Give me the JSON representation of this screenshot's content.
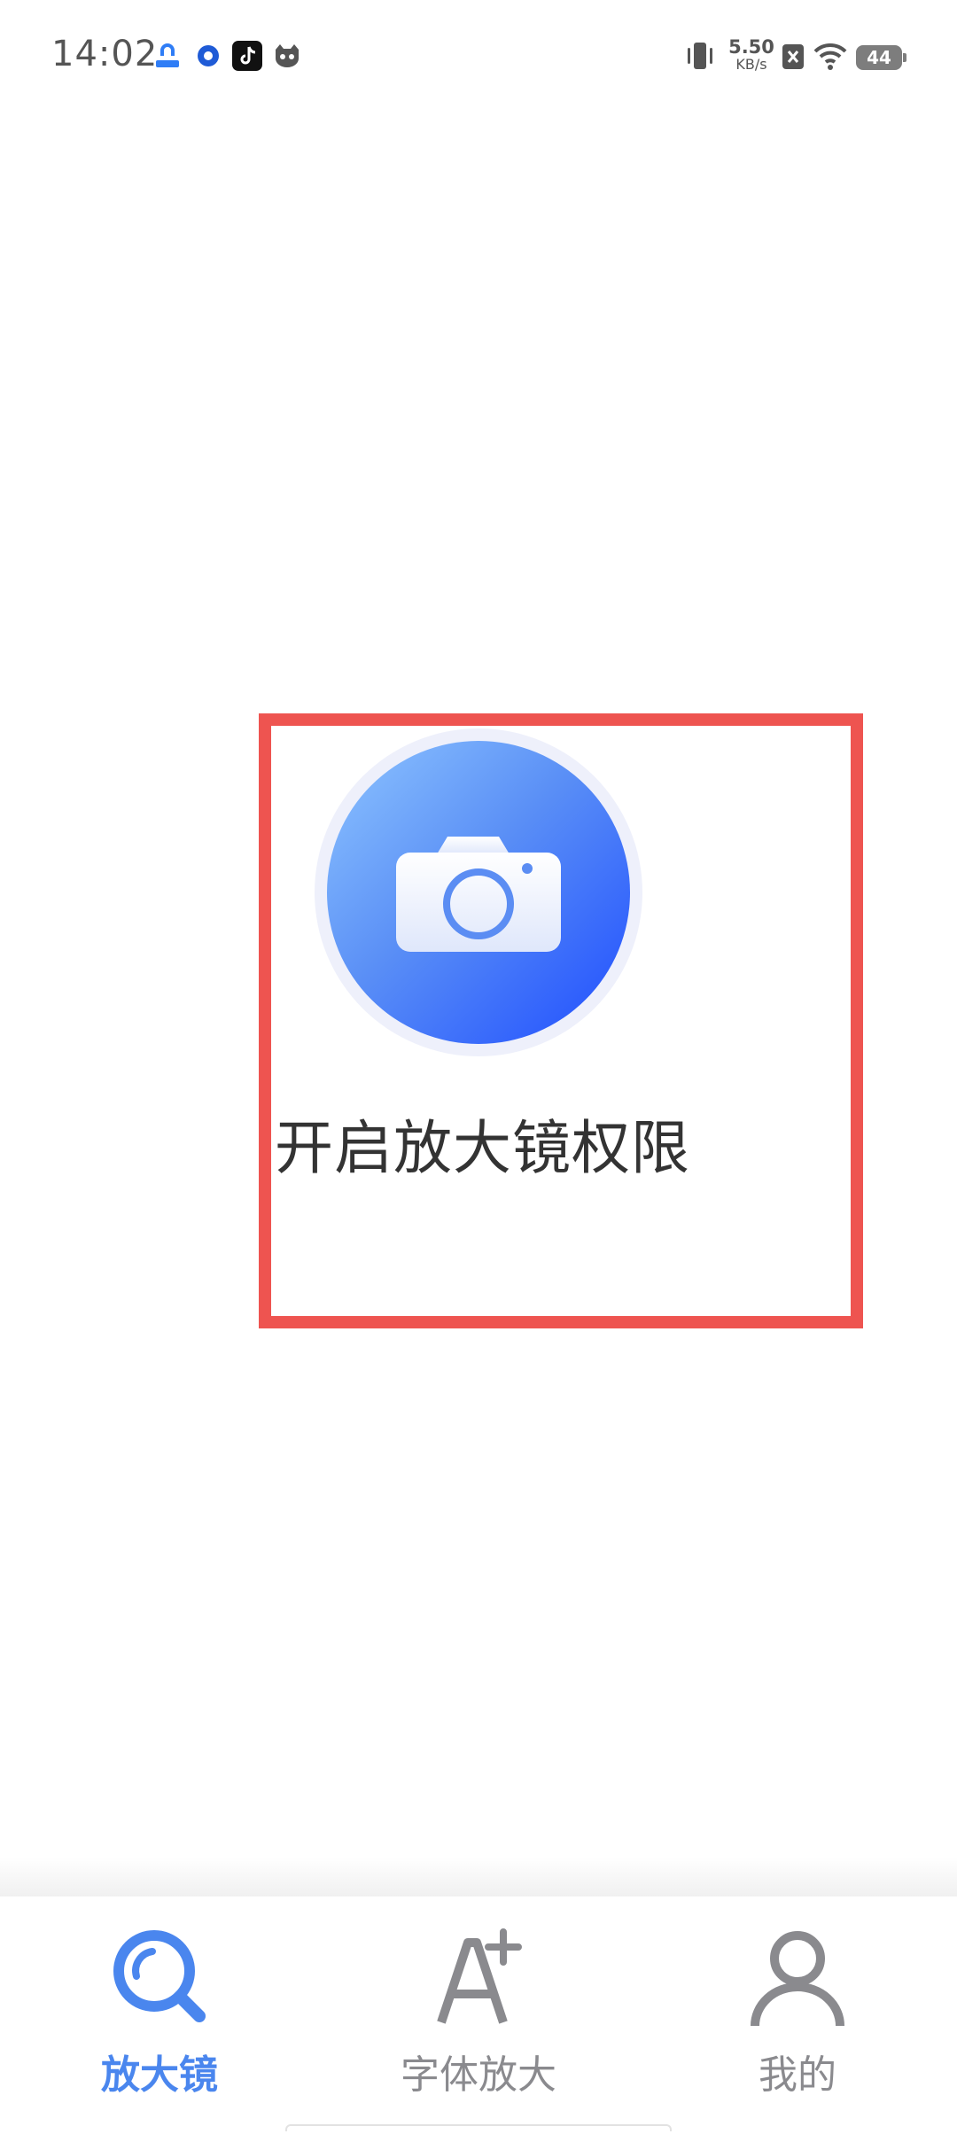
{
  "status_bar": {
    "time": "14:02",
    "net_speed_value": "5.50",
    "net_speed_unit": "KB/s",
    "battery_level": "44",
    "notification_icons": [
      "cloud-drive-icon",
      "browser-icon",
      "tiktok-icon",
      "cat-app-icon"
    ],
    "status_icons": [
      "vibrate-icon",
      "sim-off-icon",
      "wifi-icon",
      "battery-icon"
    ]
  },
  "main": {
    "permission_label": "开启放大镜权限",
    "camera_icon": "camera-icon",
    "highlight_color": "#ee5450",
    "gradient_colors": [
      "#8ec5ff",
      "#1f4dff"
    ]
  },
  "nav": {
    "items": [
      {
        "label": "放大镜",
        "icon": "magnifier-icon",
        "active": true
      },
      {
        "label": "字体放大",
        "icon": "font-enlarge-icon",
        "active": false
      },
      {
        "label": "我的",
        "icon": "profile-icon",
        "active": false
      }
    ],
    "active_color": "#4a86ee",
    "inactive_color": "#8a8a8e"
  }
}
